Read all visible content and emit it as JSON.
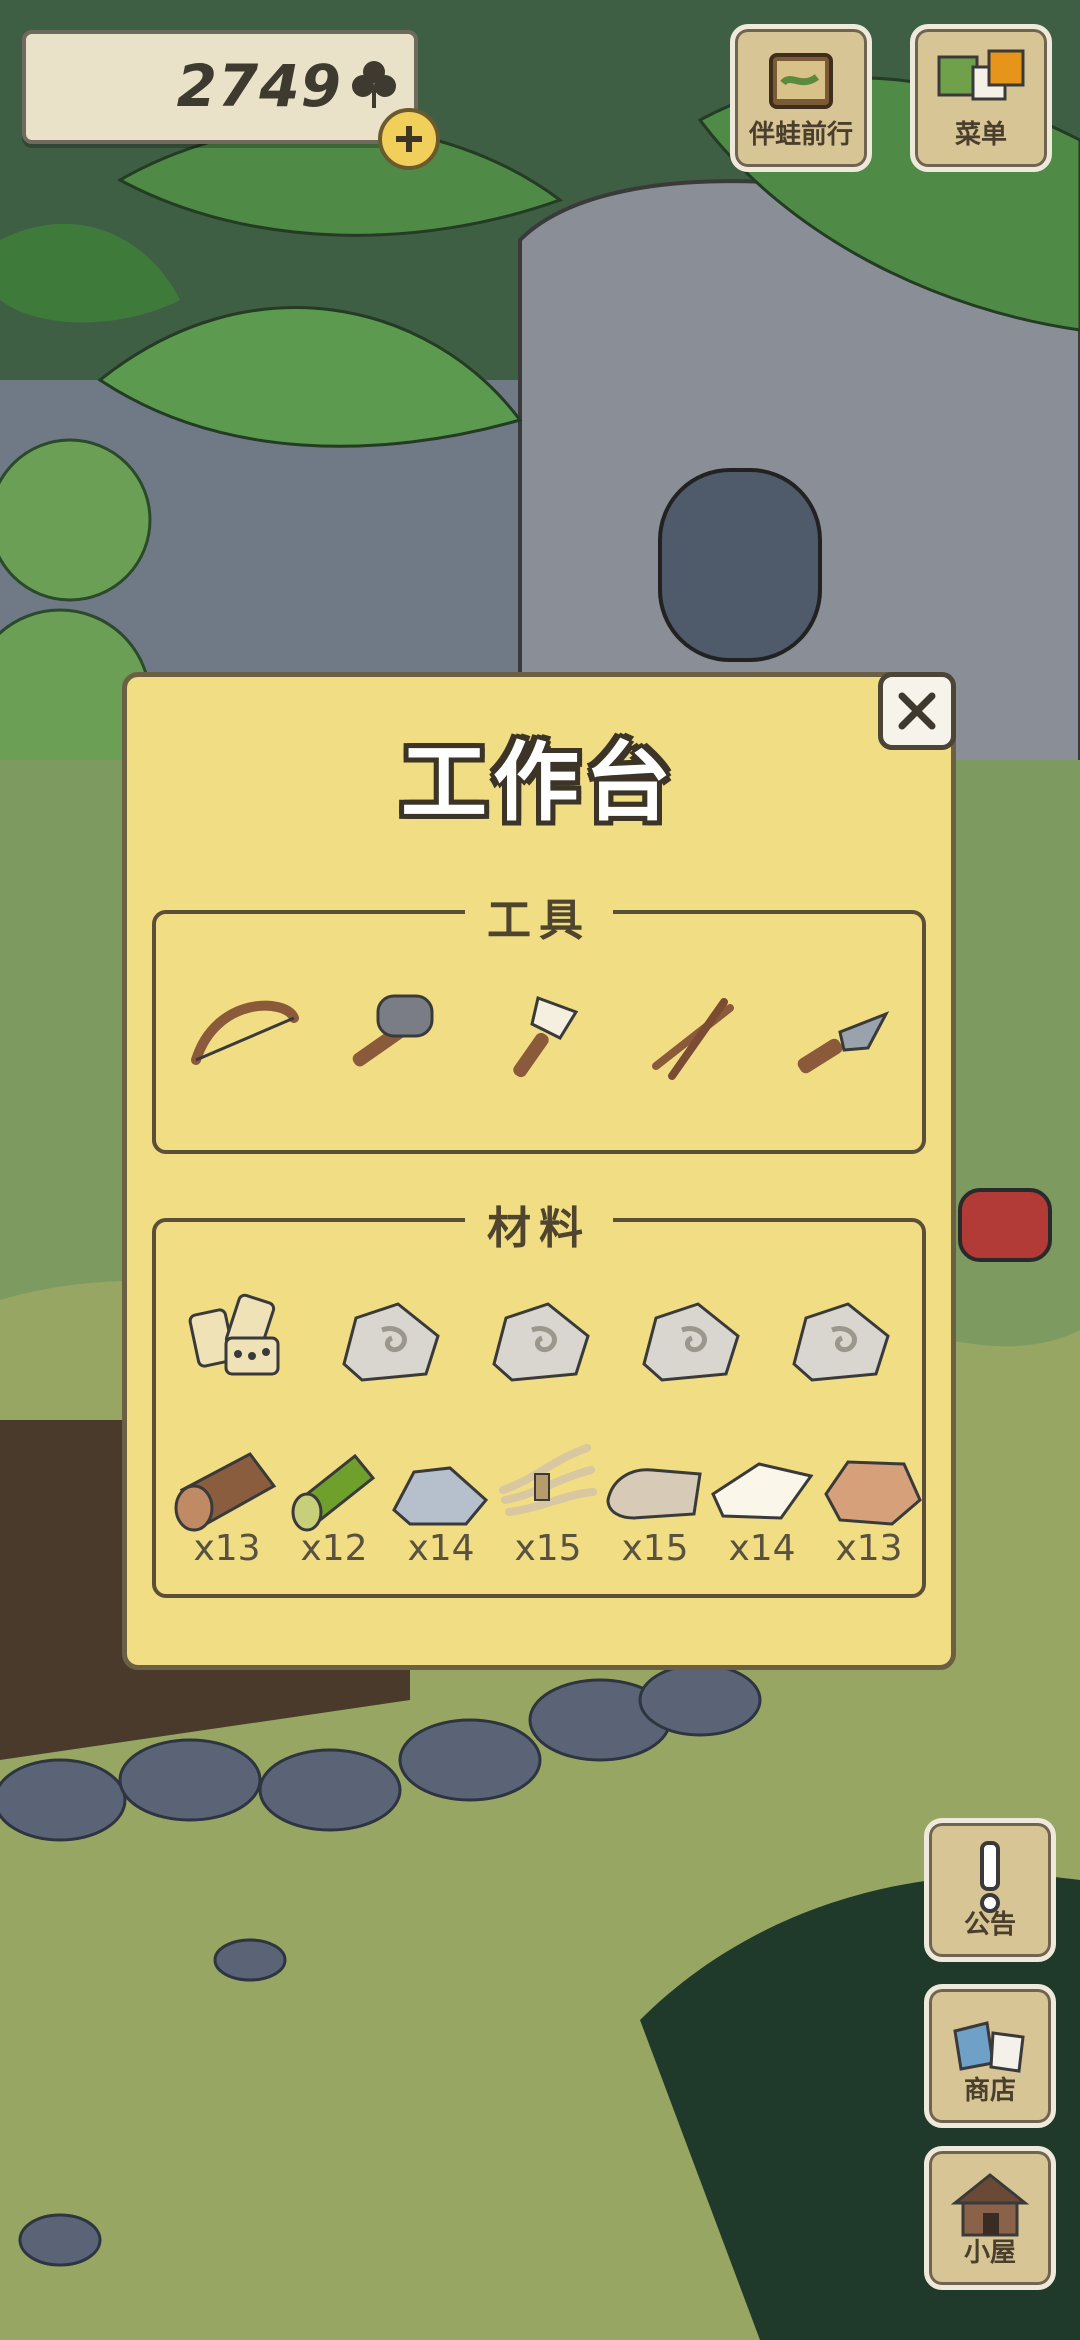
{
  "currency": {
    "amount": "2749",
    "icon": "clover-icon"
  },
  "top_buttons": [
    {
      "label": "伴蛙前行",
      "icon": "map-book-icon"
    },
    {
      "label": "菜单",
      "icon": "menu-cards-icon"
    }
  ],
  "side_buttons": [
    {
      "label": "公告",
      "icon": "exclamation-icon"
    },
    {
      "label": "商店",
      "icon": "shop-bags-icon"
    },
    {
      "label": "小屋",
      "icon": "house-icon"
    }
  ],
  "modal": {
    "title": "工作台",
    "tools_title": "工具",
    "materials_title": "材料",
    "tools": [
      {
        "name": "bow-icon"
      },
      {
        "name": "stone-hammer-icon"
      },
      {
        "name": "brush-icon"
      },
      {
        "name": "sticks-icon"
      },
      {
        "name": "knife-icon"
      }
    ],
    "materials_top": [
      {
        "name": "dominoes-icon"
      },
      {
        "name": "carved-stone-icon"
      },
      {
        "name": "carved-stone-icon"
      },
      {
        "name": "carved-stone-icon"
      },
      {
        "name": "carved-stone-icon"
      }
    ],
    "materials_bottom": [
      {
        "name": "log-icon",
        "count": "x13"
      },
      {
        "name": "bamboo-icon",
        "count": "x12"
      },
      {
        "name": "stone-icon",
        "count": "x14"
      },
      {
        "name": "fiber-bundle-icon",
        "count": "x15"
      },
      {
        "name": "leather-icon",
        "count": "x15"
      },
      {
        "name": "paper-icon",
        "count": "x14"
      },
      {
        "name": "clay-icon",
        "count": "x13"
      }
    ]
  },
  "colors": {
    "modal_bg": "#f1dd84",
    "modal_border": "#6b6043",
    "tile_bg": "#d8c596"
  }
}
